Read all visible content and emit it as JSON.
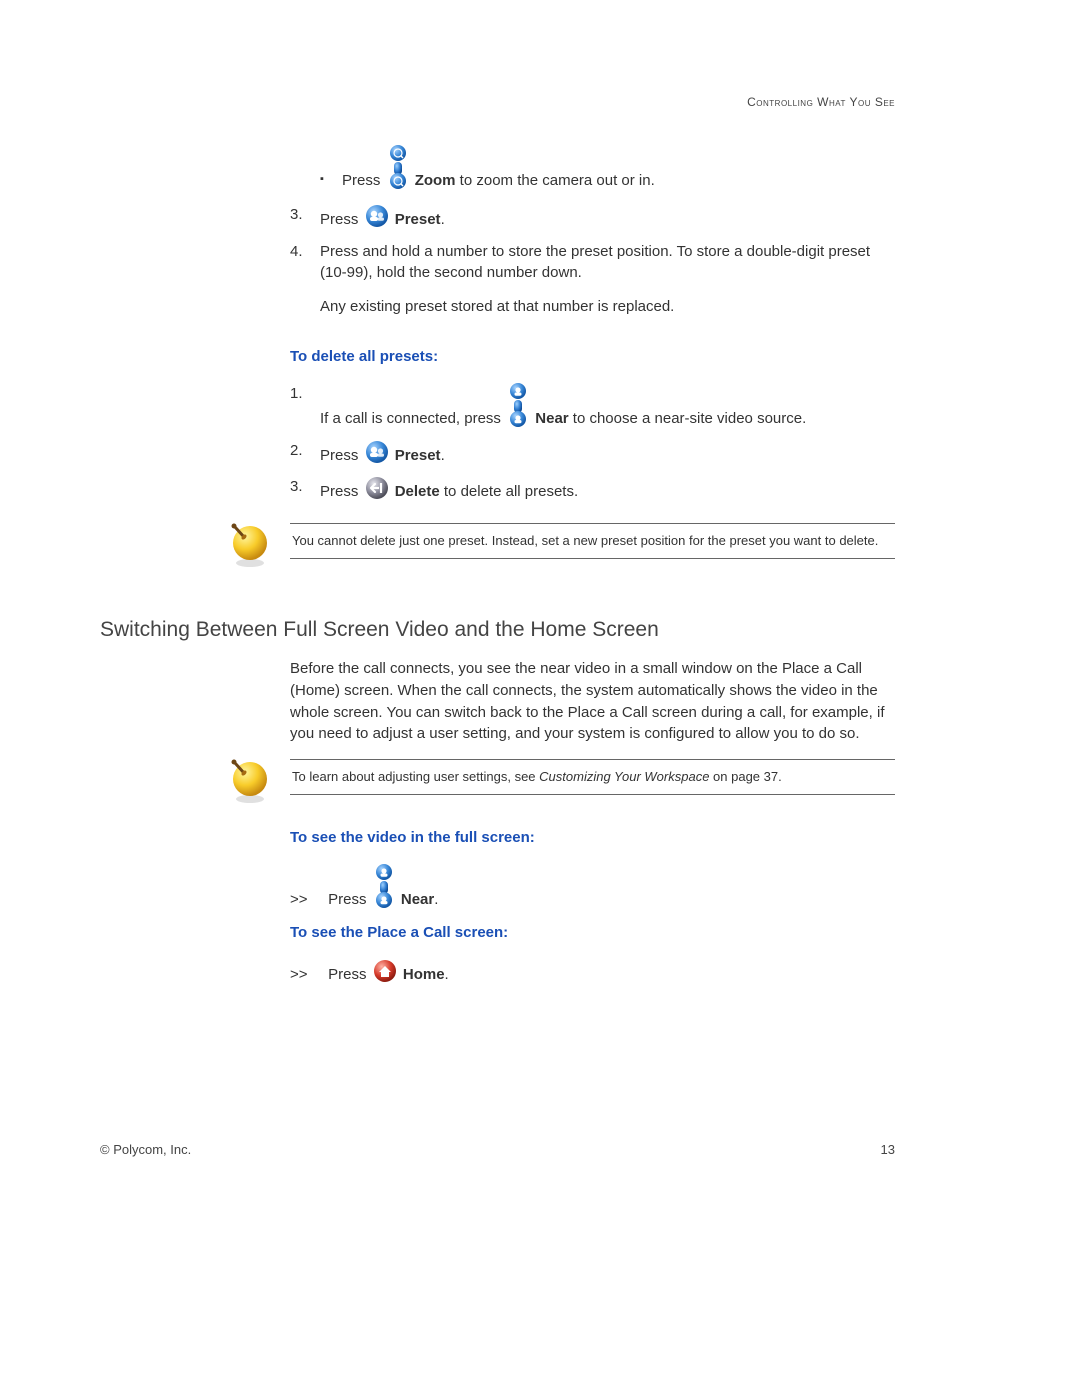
{
  "header": {
    "chapter": "Controlling What You See"
  },
  "bullet": {
    "zoom_pre": "Press ",
    "zoom_bold": "Zoom",
    "zoom_post": " to zoom the camera out or in."
  },
  "steps_top": {
    "s3": {
      "num": "3.",
      "pre": "Press ",
      "bold": "Preset",
      "post": "."
    },
    "s4": {
      "num": "4.",
      "line1": "Press and hold a number to store the preset position. To store a double-digit preset (10-99), hold the second number down.",
      "line2": "Any existing preset stored at that number is replaced."
    }
  },
  "delete_presets": {
    "heading": "To delete all presets:",
    "s1": {
      "num": "1.",
      "pre": "If a call is connected, press ",
      "bold": "Near",
      "post": " to choose a near-site video source."
    },
    "s2": {
      "num": "2.",
      "pre": "Press ",
      "bold": "Preset",
      "post": "."
    },
    "s3": {
      "num": "3.",
      "pre": "Press ",
      "bold": "Delete",
      "post": " to delete all presets."
    }
  },
  "note1": "You cannot delete just one preset. Instead, set a new preset position for the preset you want to delete.",
  "section": "Switching Between Full Screen Video and the Home Screen",
  "section_para": "Before the call connects, you see the near video in a small window on the Place a Call (Home) screen. When the call connects, the system automatically shows the video in the whole screen. You can switch back to the Place a Call screen during a call, for example, if you need to adjust a user setting, and your system is configured to allow you to do so.",
  "note2": {
    "pre": "To learn about adjusting user settings, see ",
    "ref": "Customizing Your Workspace",
    "post": " on page 37."
  },
  "fullscreen": {
    "heading": "To see the video in the full screen:",
    "arrow": ">>",
    "pre": "Press ",
    "bold": "Near",
    "post": "."
  },
  "placecall": {
    "heading": "To see the Place a Call screen:",
    "arrow": ">>",
    "pre": "Press ",
    "bold": "Home",
    "post": "."
  },
  "footer": {
    "left": "© Polycom, Inc.",
    "right": "13"
  }
}
